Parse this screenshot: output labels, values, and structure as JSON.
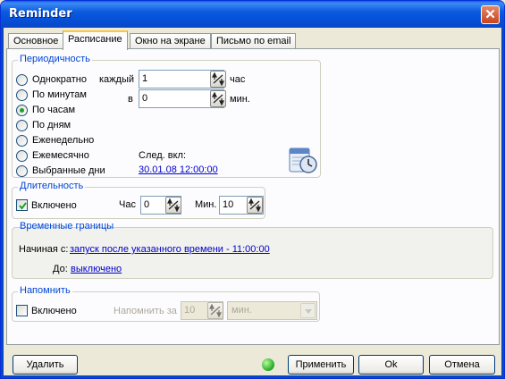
{
  "window": {
    "title": "Reminder",
    "close_glyph": "✕"
  },
  "tabs": [
    {
      "label": "Основное"
    },
    {
      "label": "Расписание",
      "active": true
    },
    {
      "label": "Окно на экране"
    },
    {
      "label": "Письмо по email"
    }
  ],
  "periodicity": {
    "title": "Периодичность",
    "options": [
      {
        "label": "Однократно",
        "selected": false
      },
      {
        "label": "По минутам",
        "selected": false
      },
      {
        "label": "По часам",
        "selected": true
      },
      {
        "label": "По дням",
        "selected": false
      },
      {
        "label": "Еженедельно",
        "selected": false
      },
      {
        "label": "Ежемесячно",
        "selected": false
      },
      {
        "label": "Выбранные дни",
        "selected": false
      }
    ],
    "every_label": "каждый",
    "every_value": "1",
    "every_unit": "час",
    "at_label": "в",
    "at_value": "0",
    "at_unit": "мин.",
    "next_label": "След. вкл:",
    "next_value": "30.01.08 12:00:00",
    "icon": "calendar-clock-icon"
  },
  "duration": {
    "title": "Длительность",
    "enabled_label": "Включено",
    "enabled": true,
    "hour_label": "Час",
    "hour_value": "0",
    "min_label": "Мин.",
    "min_value": "10"
  },
  "time_bounds": {
    "title": "Временные границы",
    "start_label": "Начиная с:",
    "start_value": "запуск после указанного времени - 11:00:00",
    "end_label": "До:",
    "end_value": "выключено"
  },
  "remind": {
    "title": "Напомнить",
    "enabled_label": "Включено",
    "enabled": false,
    "remind_label": "Напомнить за",
    "remind_value": "10",
    "unit_value": "мин."
  },
  "footer": {
    "delete_label": "Удалить",
    "apply_label": "Применить",
    "ok_label": "Ok",
    "cancel_label": "Отмена",
    "status_color": "#2FB82F"
  },
  "colors": {
    "accent": "#0046D5",
    "link": "#0000CC",
    "titlebar": "#0A5FE8"
  }
}
